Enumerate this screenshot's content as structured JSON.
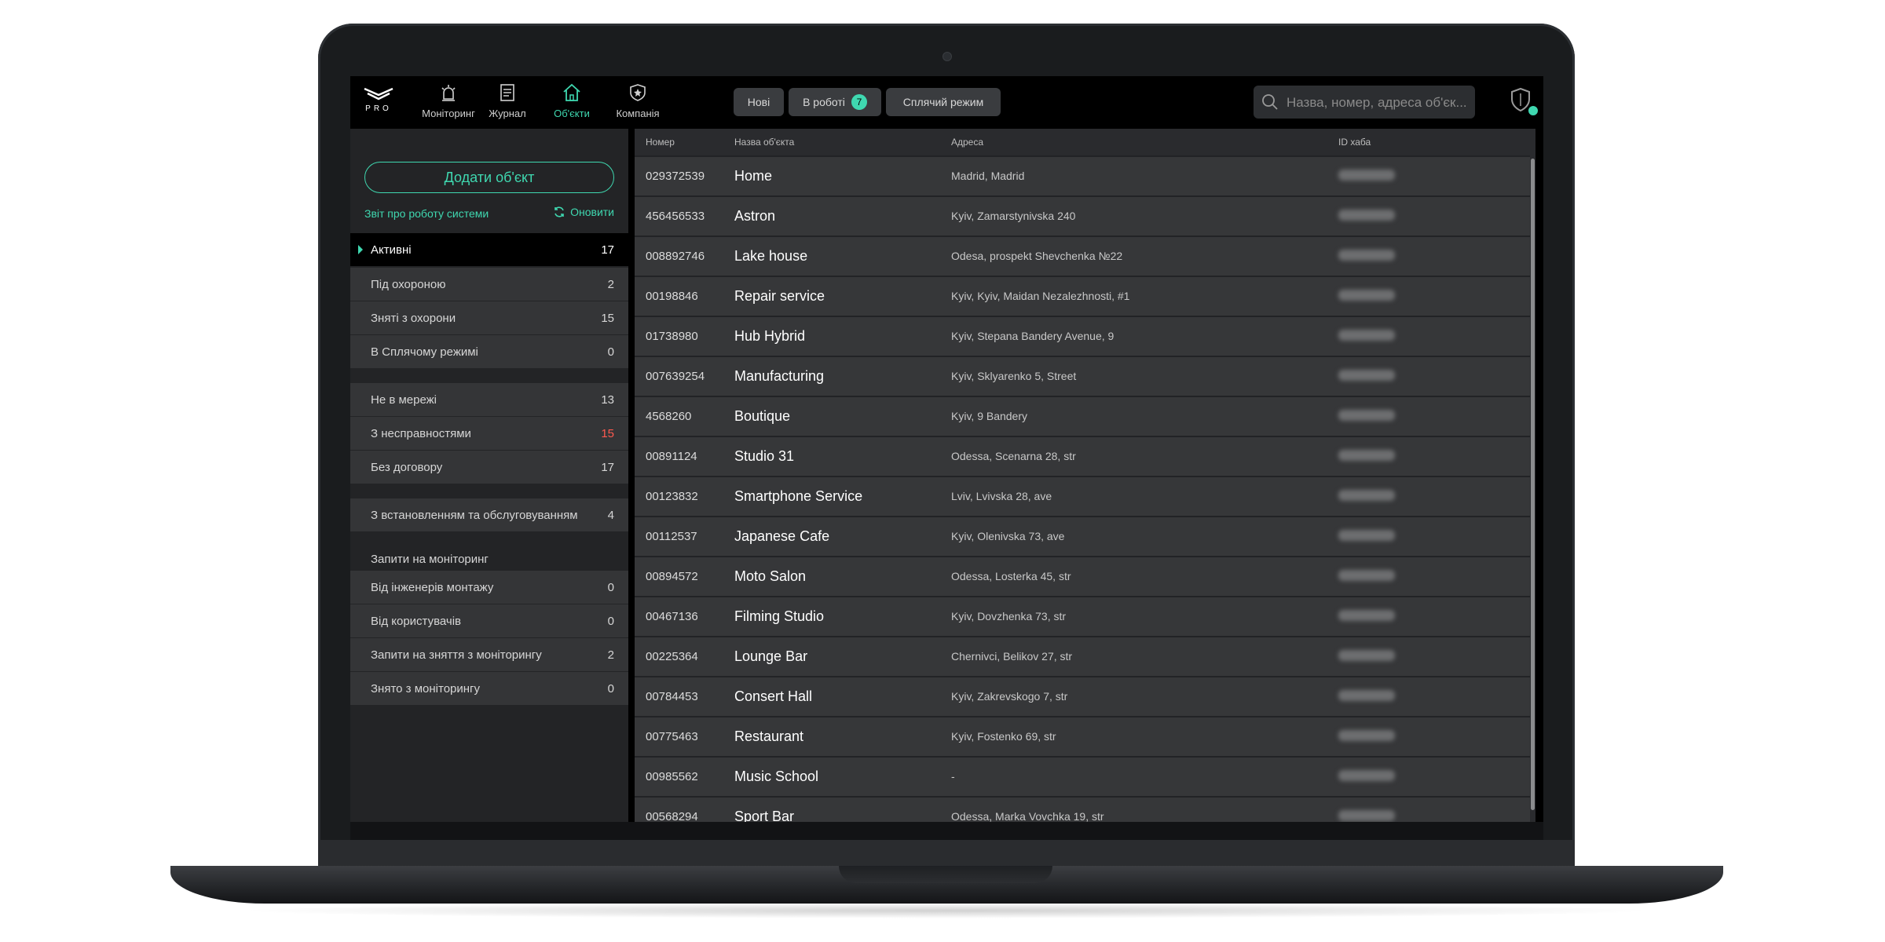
{
  "app": {
    "logo_text": "PRO"
  },
  "nav": [
    {
      "label": "Моніторинг",
      "icon": "alarm-bell-icon"
    },
    {
      "label": "Журнал",
      "icon": "journal-icon"
    },
    {
      "label": "Об'єкти",
      "icon": "home-icon",
      "active": true
    },
    {
      "label": "Компанія",
      "icon": "company-shield-icon"
    }
  ],
  "chips": {
    "new": "Нові",
    "in_work": "В роботі",
    "in_work_count": "7",
    "sleep": "Сплячий режим"
  },
  "search": {
    "placeholder": "Назва, номер, адреса об'єк..."
  },
  "sidebar": {
    "add_button": "Додати об'єкт",
    "report_link": "Звіт про роботу системи",
    "refresh": "Оновити",
    "group1": [
      {
        "label": "Активні",
        "count": "17",
        "active": true
      },
      {
        "label": "Під охороною",
        "count": "2"
      },
      {
        "label": "Зняті з охорони",
        "count": "15"
      },
      {
        "label": "В Сплячому режимі",
        "count": "0"
      }
    ],
    "group2": [
      {
        "label": "Не в мережі",
        "count": "13"
      },
      {
        "label": "З несправностями",
        "count": "15",
        "alert": true
      },
      {
        "label": "Без договору",
        "count": "17"
      }
    ],
    "group3": [
      {
        "label": "З встановленням та обслуговуванням",
        "count": "4"
      }
    ],
    "requests_heading": "Запити на моніторинг",
    "group4": [
      {
        "label": "Від інженерів монтажу",
        "count": "0"
      },
      {
        "label": "Від користувачів",
        "count": "0"
      },
      {
        "label": "Запити на зняття з моніторингу",
        "count": "2"
      },
      {
        "label": "Знято з моніторингу",
        "count": "0"
      }
    ]
  },
  "table": {
    "headers": [
      "Номер",
      "Назва об'єкта",
      "Адреса",
      "ID хаба"
    ],
    "rows": [
      [
        "029372539",
        "Home",
        "Madrid, Madrid"
      ],
      [
        "456456533",
        "Astron",
        "Kyiv, Zamarstynivska 240"
      ],
      [
        "008892746",
        "Lake house",
        "Odesa, prospekt Shevchenka №22"
      ],
      [
        "00198846",
        "Repair service",
        "Kyiv, Kyiv, Maidan Nezalezhnosti, #1"
      ],
      [
        "01738980",
        "Hub Hybrid",
        "Kyiv, Stepana Bandery Avenue, 9"
      ],
      [
        "007639254",
        "Manufacturing",
        "Kyiv, Sklyarenko 5, Street"
      ],
      [
        "4568260",
        "Boutique",
        "Kyiv, 9 Bandery"
      ],
      [
        "00891124",
        "Studio 31",
        "Odessa, Scenarna 28, str"
      ],
      [
        "00123832",
        "Smartphone Service",
        "Lviv, Lvivska 28, ave"
      ],
      [
        "00112537",
        "Japanese Cafe",
        "Kyiv, Olenivska 73, ave"
      ],
      [
        "00894572",
        "Moto Salon",
        "Odessa, Losterka 45, str"
      ],
      [
        "00467136",
        "Filming Studio",
        "Kyiv, Dovzhenka 73, str"
      ],
      [
        "00225364",
        "Lounge Bar",
        "Chernivci, Belikov 27, str"
      ],
      [
        "00784453",
        "Consert Hall",
        "Kyiv, Zakrevskogo 7, str"
      ],
      [
        "00775463",
        "Restaurant",
        "Kyiv, Fostenko 69, str"
      ],
      [
        "00985562",
        "Music School",
        "-"
      ],
      [
        "00568294",
        "Sport Bar",
        "Odessa, Marka Vovchka 19, str"
      ]
    ]
  },
  "colors": {
    "accent": "#3fd8b0",
    "alert": "#ff5a4f"
  }
}
